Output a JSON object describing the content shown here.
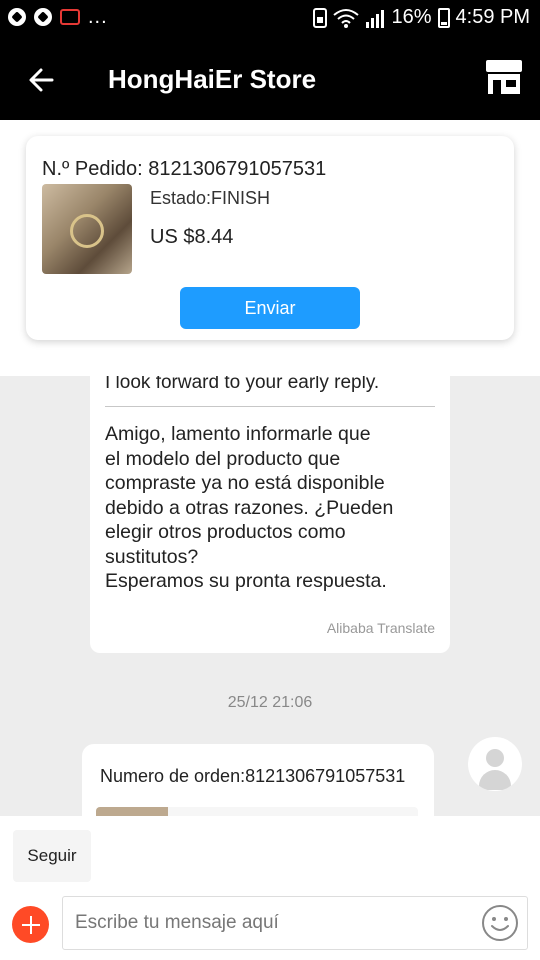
{
  "status_bar": {
    "dots": "...",
    "battery": "16%",
    "time": "4:59 PM"
  },
  "header": {
    "title": "HongHaiEr Store",
    "back_icon": "arrow-left-icon",
    "store_icon": "storefront-icon"
  },
  "order_card": {
    "order_number": "N.º Pedido: 8121306791057531",
    "status": "Estado:FINISH",
    "price": "US $8.44",
    "send_label": "Enviar"
  },
  "chat": {
    "message": {
      "original_text": "I look forward to your early reply.",
      "translated_text": "Amigo, lamento informarle que\nel modelo del producto que\ncompraste ya no está disponible\ndebido a otras razones. ¿Pueden\nelegir otros productos como\nsustitutos?\nEsperamos su pronta respuesta.",
      "translation_source": "Alibaba Translate"
    },
    "timestamp": "25/12 21:06",
    "order_message": {
      "text": "Numero de orden:8121306791057531"
    }
  },
  "composer": {
    "follow_label": "Seguir",
    "placeholder": "Escribe tu mensaje aquí"
  },
  "colors": {
    "accent": "#1e9cff",
    "plus_button": "#ff4a26",
    "header_bg": "#000000"
  }
}
